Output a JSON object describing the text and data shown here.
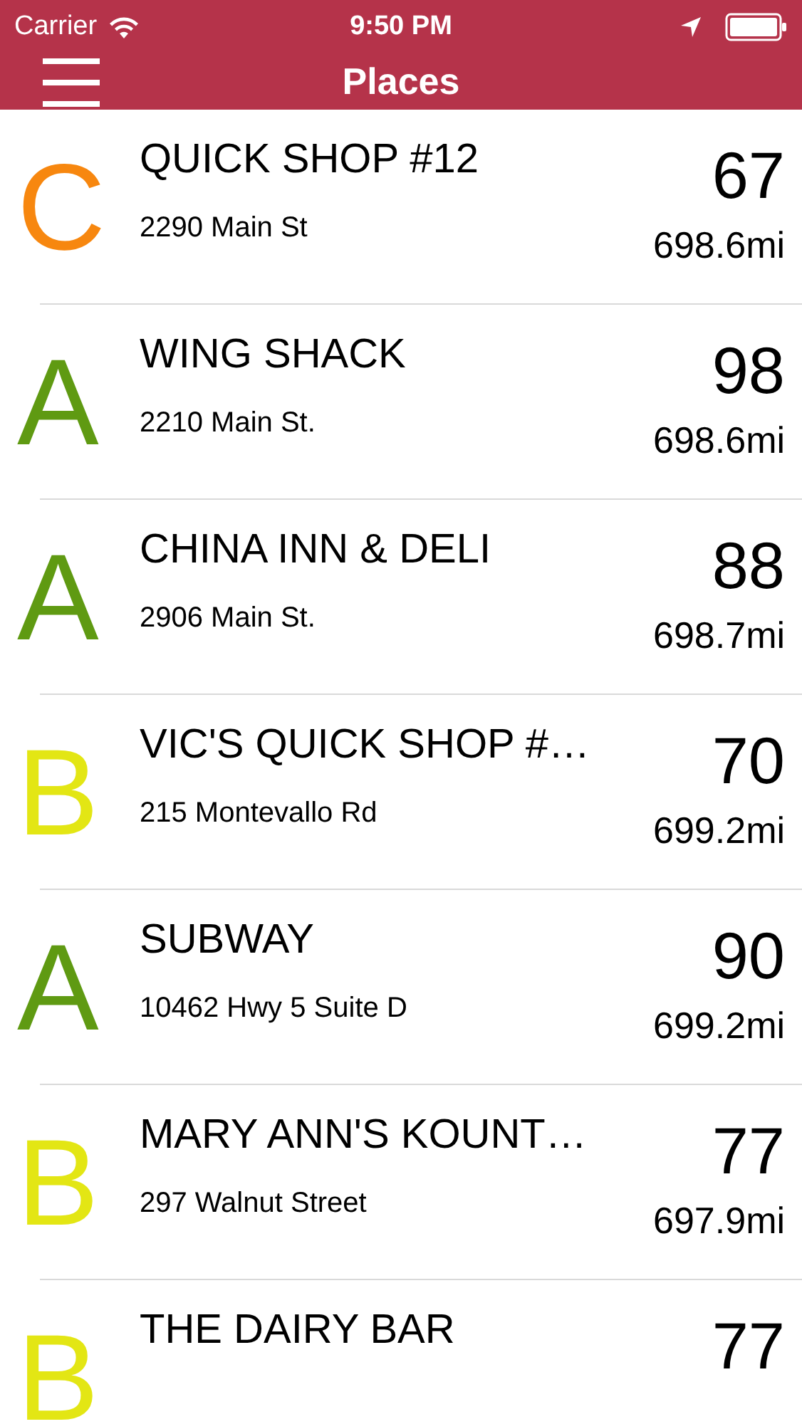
{
  "status_bar": {
    "carrier": "Carrier",
    "time": "9:50 PM"
  },
  "nav_bar": {
    "title": "Places"
  },
  "places": [
    {
      "grade": "C",
      "color": "#f7870f",
      "name": "QUICK SHOP #12",
      "address": "2290 Main St",
      "score": "67",
      "distance": "698.6mi"
    },
    {
      "grade": "A",
      "color": "#5f9a12",
      "name": "WING SHACK",
      "address": "2210 Main St.",
      "score": "98",
      "distance": "698.6mi"
    },
    {
      "grade": "A",
      "color": "#5f9a12",
      "name": "CHINA INN & DELI",
      "address": "2906 Main St.",
      "score": "88",
      "distance": "698.7mi"
    },
    {
      "grade": "B",
      "color": "#e3e614",
      "name": "VIC'S QUICK SHOP #…",
      "address": "215 Montevallo Rd",
      "score": "70",
      "distance": "699.2mi"
    },
    {
      "grade": "A",
      "color": "#5f9a12",
      "name": "SUBWAY",
      "address": "10462 Hwy 5 Suite D",
      "score": "90",
      "distance": "699.2mi"
    },
    {
      "grade": "B",
      "color": "#e3e614",
      "name": "MARY ANN'S KOUNT…",
      "address": "297 Walnut Street",
      "score": "77",
      "distance": "697.9mi"
    },
    {
      "grade": "B",
      "color": "#e3e614",
      "name": "THE DAIRY BAR",
      "score": "77"
    }
  ]
}
